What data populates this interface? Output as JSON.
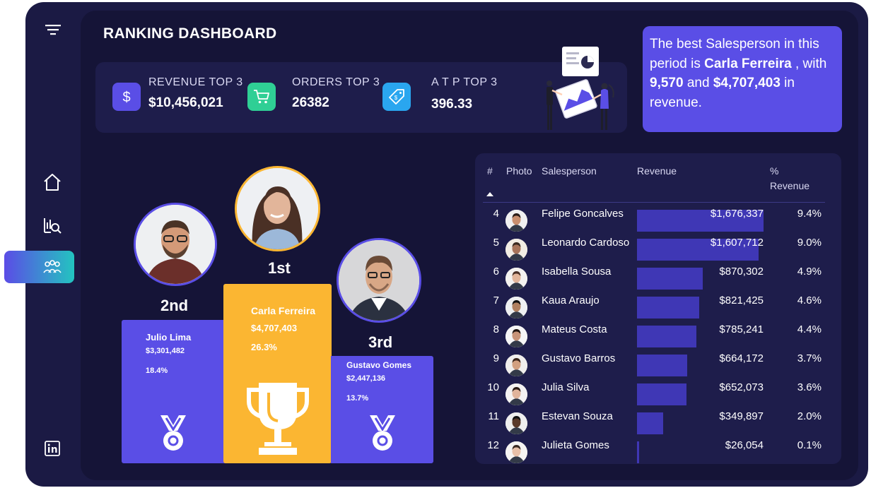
{
  "header": {
    "title": "RANKING DASHBOARD"
  },
  "sidebar": {
    "items": [
      {
        "icon": "filter-icon"
      },
      {
        "icon": "home-icon"
      },
      {
        "icon": "analytics-search-icon"
      },
      {
        "icon": "team-icon",
        "active": true
      },
      {
        "icon": "linkedin-icon"
      }
    ]
  },
  "kpis": [
    {
      "label": "REVENUE TOP 3",
      "value": "$10,456,021",
      "icon": "dollar-icon",
      "color": "#5a4ee6"
    },
    {
      "label": "ORDERS TOP 3",
      "value": "26382",
      "icon": "cart-icon",
      "color": "#2fcf95"
    },
    {
      "label": "A T P TOP 3",
      "value": "396.33",
      "icon": "price-tag-icon",
      "color": "#2aa6ef"
    }
  ],
  "best": {
    "prefix": "The best Salesperson in this period is ",
    "name": "Carla Ferreira",
    "mid": " , with ",
    "orders": "9,570",
    "and": " and ",
    "revenue": "$4,707,403",
    "suffix": " in revenue."
  },
  "podium": [
    {
      "rank": "2nd",
      "name": "Julio Lima",
      "revenue": "$3,301,482",
      "pct": "18.4%",
      "color": "#5a4ee6"
    },
    {
      "rank": "1st",
      "name": "Carla Ferreira",
      "revenue": "$4,707,403",
      "pct": "26.3%",
      "color": "#fbb632"
    },
    {
      "rank": "3rd",
      "name": "Gustavo Gomes",
      "revenue": "$2,447,136",
      "pct": "13.7%",
      "color": "#5a4ee6"
    }
  ],
  "table": {
    "columns": [
      "#",
      "Photo",
      "Salesperson",
      "Revenue",
      "%",
      "Revenue"
    ],
    "sort_icon": "sort-up-icon",
    "max_revenue": 1676337,
    "rows": [
      {
        "rank": "4",
        "name": "Felipe Goncalves",
        "revenue": "$1,676,337",
        "revenue_value": 1676337,
        "pct": "9.4%"
      },
      {
        "rank": "5",
        "name": "Leonardo Cardoso",
        "revenue": "$1,607,712",
        "revenue_value": 1607712,
        "pct": "9.0%"
      },
      {
        "rank": "6",
        "name": "Isabella Sousa",
        "revenue": "$870,302",
        "revenue_value": 870302,
        "pct": "4.9%"
      },
      {
        "rank": "7",
        "name": "Kaua Araujo",
        "revenue": "$821,425",
        "revenue_value": 821425,
        "pct": "4.6%"
      },
      {
        "rank": "8",
        "name": "Mateus Costa",
        "revenue": "$785,241",
        "revenue_value": 785241,
        "pct": "4.4%"
      },
      {
        "rank": "9",
        "name": "Gustavo Barros",
        "revenue": "$664,172",
        "revenue_value": 664172,
        "pct": "3.7%"
      },
      {
        "rank": "10",
        "name": "Julia Silva",
        "revenue": "$652,073",
        "revenue_value": 652073,
        "pct": "3.6%"
      },
      {
        "rank": "11",
        "name": "Estevan Souza",
        "revenue": "$349,897",
        "revenue_value": 349897,
        "pct": "2.0%"
      },
      {
        "rank": "12",
        "name": "Julieta Gomes",
        "revenue": "$26,054",
        "revenue_value": 26054,
        "pct": "0.1%"
      }
    ]
  },
  "colors": {
    "background": "#1b1a44",
    "panel": "#1e1d4b",
    "accent": "#5a4ee6",
    "gold": "#fbb632",
    "bar": "#3f37b5"
  }
}
